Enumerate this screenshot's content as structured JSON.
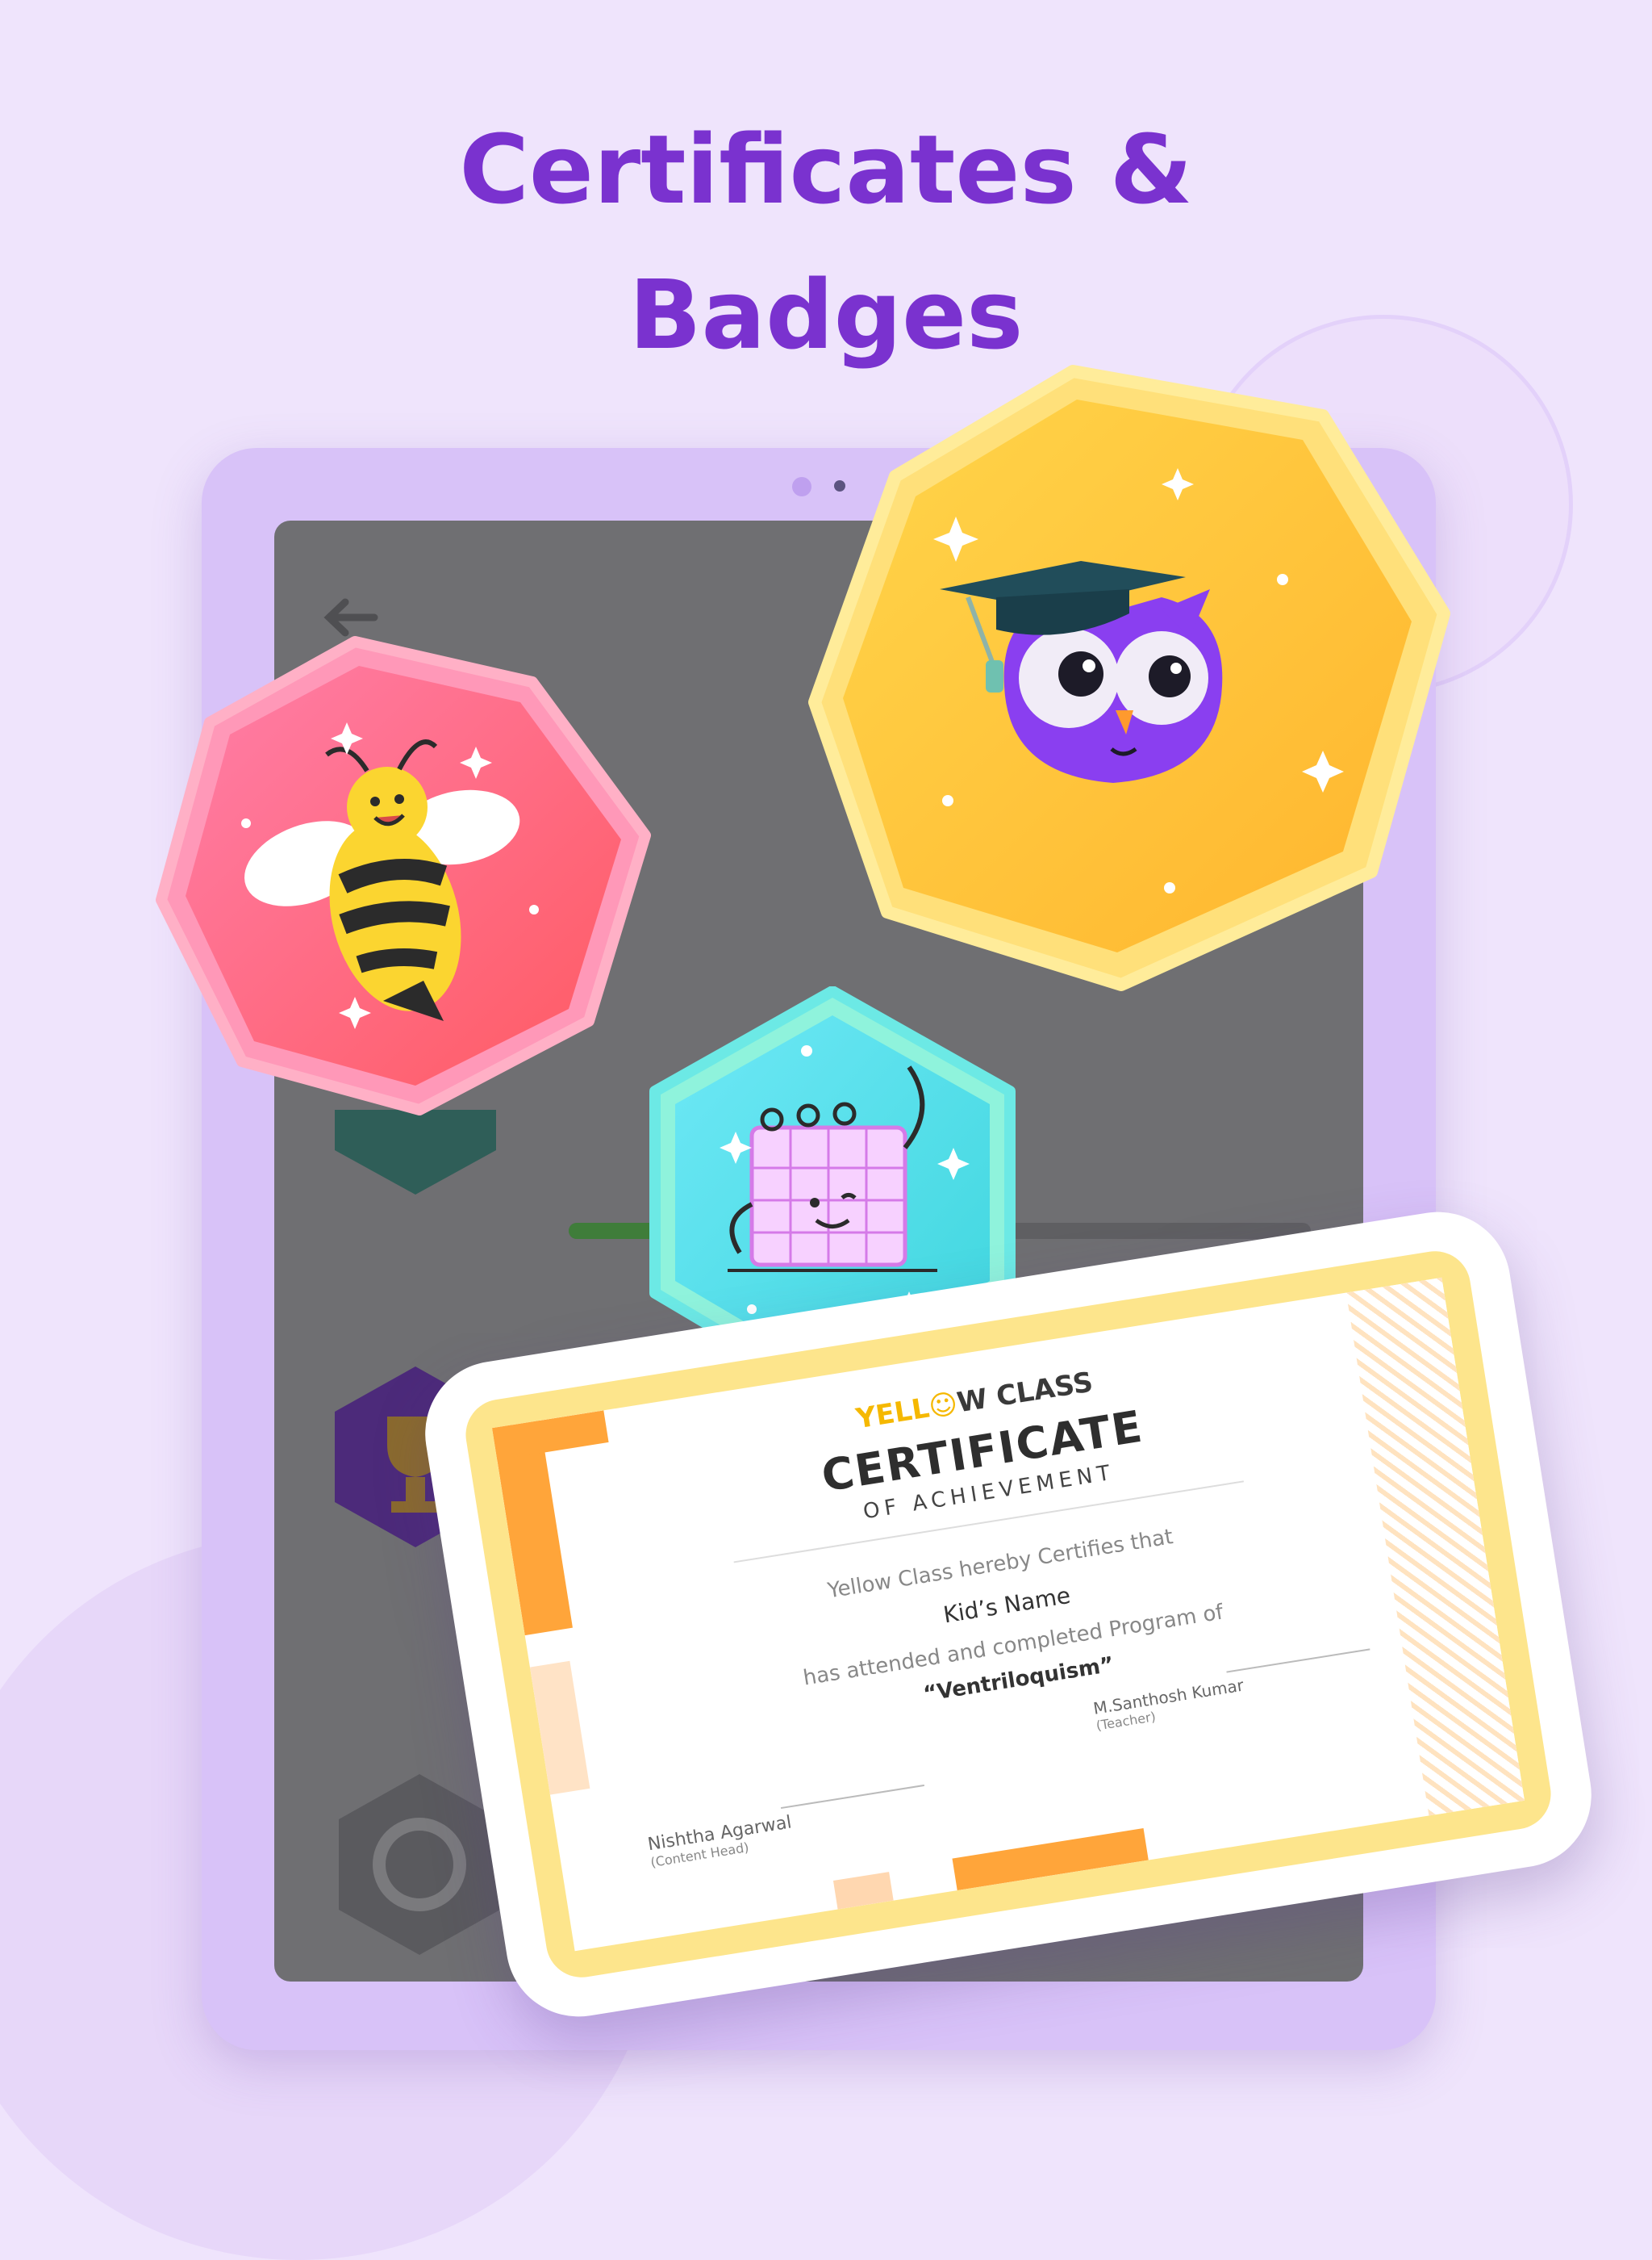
{
  "headline": {
    "line1": "Certificates &",
    "line2": "Badges"
  },
  "certificate": {
    "brand_left": "YELL",
    "brand_right": "W CLASS",
    "title": "CERTIFICATE",
    "subtitle": "OF ACHIEVEMENT",
    "certifies_line": "Yellow Class hereby Certifies that",
    "kid_name": "Kid’s Name",
    "program_line": "has attended and completed Program of",
    "program_name": "“Ventriloquism”",
    "signer_left_name": "Nishtha Agarwal",
    "signer_left_role": "(Content Head)",
    "signer_right_name": "M.Santhosh Kumar",
    "signer_right_role": "(Teacher)"
  },
  "badges": {
    "bee": {
      "icon": "bee-icon",
      "color": "#ff6478"
    },
    "owl": {
      "icon": "owl-graduate-icon",
      "color": "#ffc233"
    },
    "calendar": {
      "icon": "calendar-icon",
      "color": "#5de6ef"
    }
  },
  "colors": {
    "background": "#efe4fc",
    "headline": "#7a32cf",
    "tablet_frame": "#d8c2f8",
    "screen": "#6f6f72",
    "cert_frame": "#fde58c",
    "accent_orange": "#ffa53a"
  }
}
